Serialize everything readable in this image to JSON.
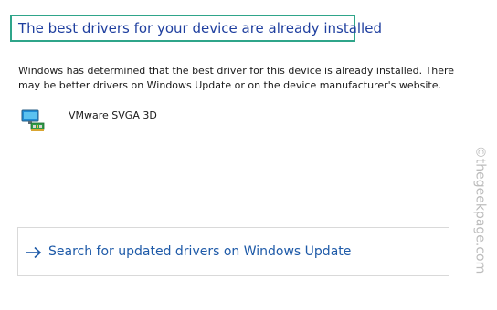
{
  "heading": "The best drivers for your device are already installed",
  "description": "Windows has determined that the best driver for this device is already installed. There may be better drivers on Windows Update or on the device manufacturer's website.",
  "device": {
    "name": "VMware SVGA 3D",
    "icon": "display-adapter-icon"
  },
  "update_link": {
    "label": "Search for updated drivers on Windows Update",
    "icon": "arrow-right-icon"
  },
  "watermark": "©thegeekpage.com",
  "colors": {
    "heading": "#1f3f9f",
    "highlight_border": "#2fa58a",
    "link": "#1e5aa8",
    "watermark": "#bcbcbc"
  }
}
